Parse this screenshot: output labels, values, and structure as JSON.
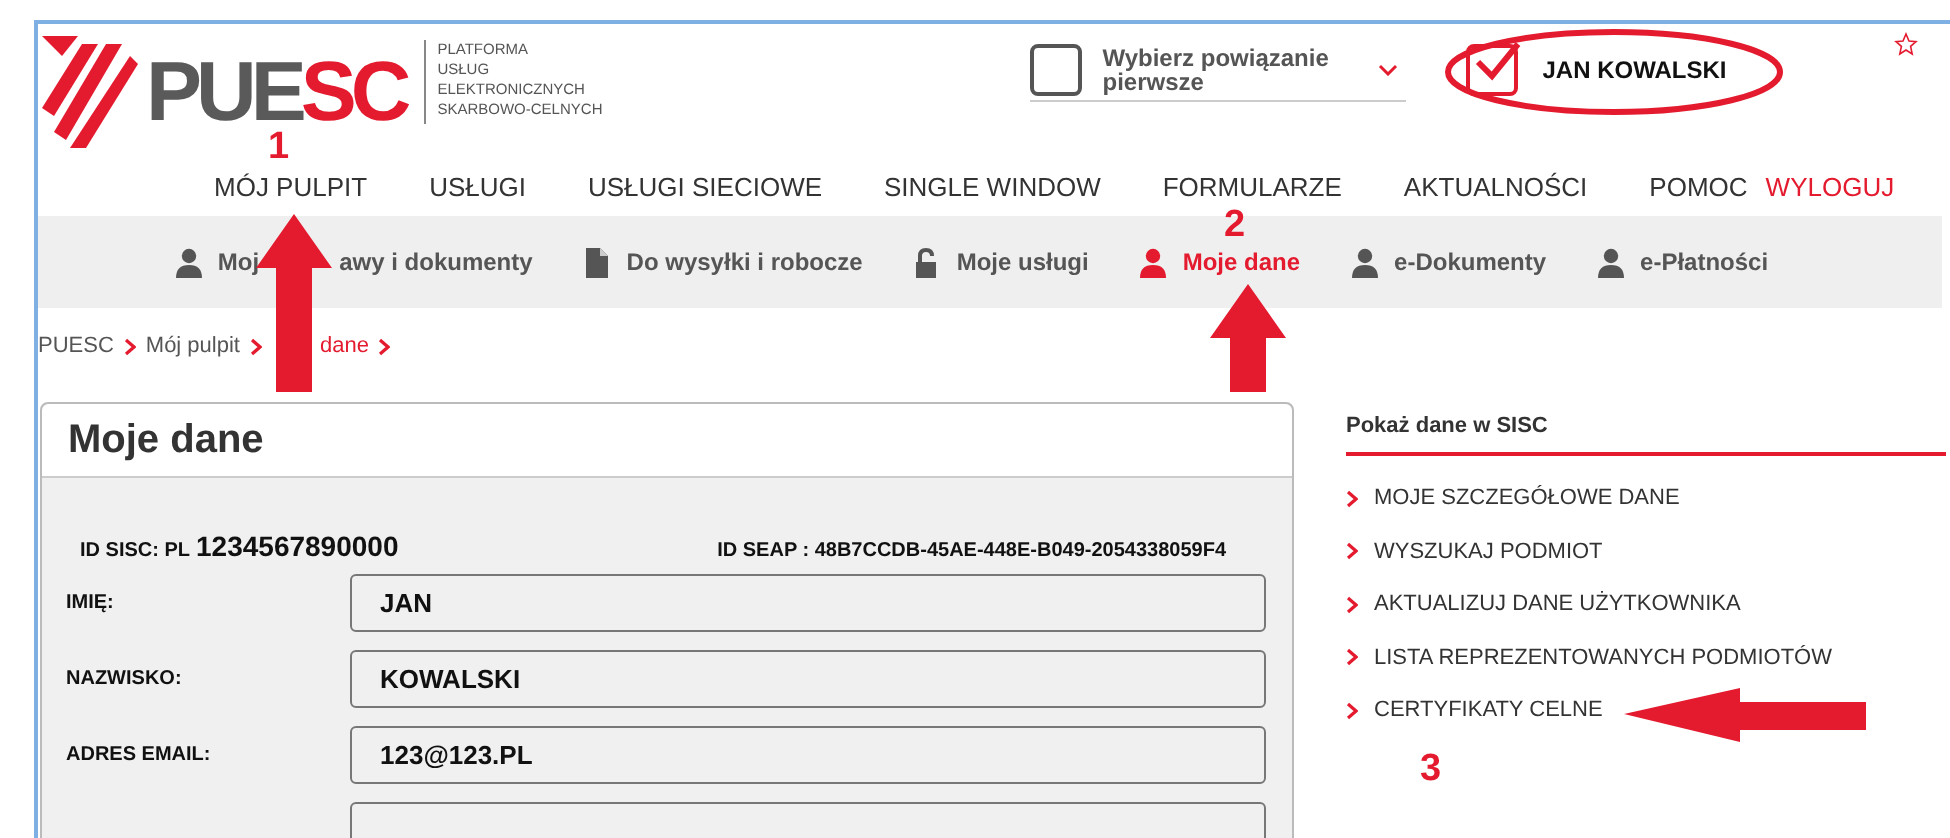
{
  "logo": {
    "brand_left": "PUE",
    "brand_right": "SC",
    "tagline": [
      "PLATFORMA",
      "USŁUG",
      "ELEKTRONICZNYCH",
      "SKARBOWO-CELNYCH"
    ]
  },
  "context_select": {
    "checked": false,
    "value": "Wybierz powiązanie pierwsze"
  },
  "user": {
    "checked": true,
    "name": "JAN KOWALSKI"
  },
  "main_nav": [
    {
      "label": "MÓJ PULPIT",
      "kind": "link"
    },
    {
      "label": "USŁUGI",
      "kind": "link"
    },
    {
      "label": "USŁUGI SIECIOWE",
      "kind": "link"
    },
    {
      "label": "SINGLE WINDOW",
      "kind": "link"
    },
    {
      "label": "FORMULARZE",
      "kind": "link"
    },
    {
      "label": "AKTUALNOŚCI",
      "kind": "link"
    },
    {
      "label": "POMOC",
      "kind": "link"
    },
    {
      "label": "WYLOGUJ",
      "kind": "logout"
    }
  ],
  "sub_nav": [
    {
      "label_parts": [
        "Moj",
        "awy i dokumenty"
      ],
      "kind": "person",
      "selected": false
    },
    {
      "label_parts": [
        "Do wysyłki i robocze"
      ],
      "kind": "document",
      "selected": false
    },
    {
      "label_parts": [
        "Moje usługi"
      ],
      "kind": "lock",
      "selected": false
    },
    {
      "label_parts": [
        "Moje dane"
      ],
      "kind": "person",
      "selected": true
    },
    {
      "label_parts": [
        "e-Dokumenty"
      ],
      "kind": "person",
      "selected": false
    },
    {
      "label_parts": [
        "e-Płatności"
      ],
      "kind": "person",
      "selected": false
    }
  ],
  "breadcrumb": [
    "PUESC",
    "Mój pulpit",
    "dane"
  ],
  "panel": {
    "title": "Moje dane",
    "id_sisc_label": "ID SISC: PL",
    "id_sisc": "1234567890000",
    "id_seap": "ID SEAP : 48B7CCDB-45AE-448E-B049-2054338059F4",
    "fields": [
      {
        "label": "IMIĘ:",
        "value": "JAN"
      },
      {
        "label": "NAZWISKO:",
        "value": "KOWALSKI"
      },
      {
        "label": "ADRES EMAIL:",
        "value": "123@123.PL"
      }
    ]
  },
  "sidebar": {
    "title": "Pokaż dane w SISC",
    "items": [
      "MOJE SZCZEGÓŁOWE DANE",
      "WYSZUKAJ PODMIOT",
      "AKTUALIZUJ DANE UŻYTKOWNIKA",
      "LISTA REPREZENTOWANYCH PODMIOTÓW",
      "CERTYFIKATY CELNE"
    ]
  },
  "annotations": [
    {
      "kind": "arrow_up",
      "label": "1"
    },
    {
      "kind": "arrow_up",
      "label": "2"
    },
    {
      "kind": "arrow_left",
      "label": "3"
    },
    {
      "kind": "ellipse"
    }
  ]
}
